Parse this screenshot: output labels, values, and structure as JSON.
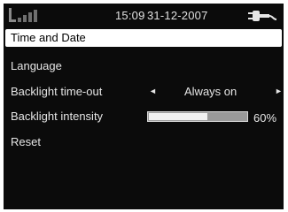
{
  "status": {
    "time": "15:09",
    "date": "31-12-2007",
    "signal_icon": "signal-bars-icon",
    "battery_icon": "battery-charging-icon"
  },
  "menu": {
    "title": "Time and Date",
    "items": [
      {
        "label": "Language"
      },
      {
        "label": "Backlight time-out",
        "value": "Always on"
      },
      {
        "label": "Backlight intensity",
        "level": 60,
        "percent_label": "60%"
      },
      {
        "label": "Reset"
      }
    ]
  },
  "colors": {
    "background": "#0b0b0b",
    "text": "#e6e6e6",
    "highlight": "#ffffff"
  }
}
